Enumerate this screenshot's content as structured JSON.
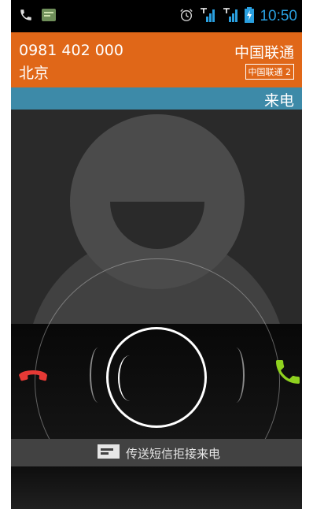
{
  "status_bar": {
    "time": "10:50",
    "icons": [
      "phone-icon",
      "message-notification-icon",
      "alarm-icon",
      "signal-icon",
      "signal-icon",
      "battery-charging-icon"
    ]
  },
  "caller": {
    "number": "0981 402 000",
    "location": "北京",
    "carrier": "中国联通",
    "sim_label": "中国联通 2"
  },
  "call_state": "来电",
  "reject_with_sms": "传送短信拒接来电",
  "colors": {
    "header": "#e06718",
    "call_state_bar": "#3d8aa8",
    "decline": "#e53935",
    "answer": "#8fd11f",
    "time": "#2aa0e0"
  }
}
